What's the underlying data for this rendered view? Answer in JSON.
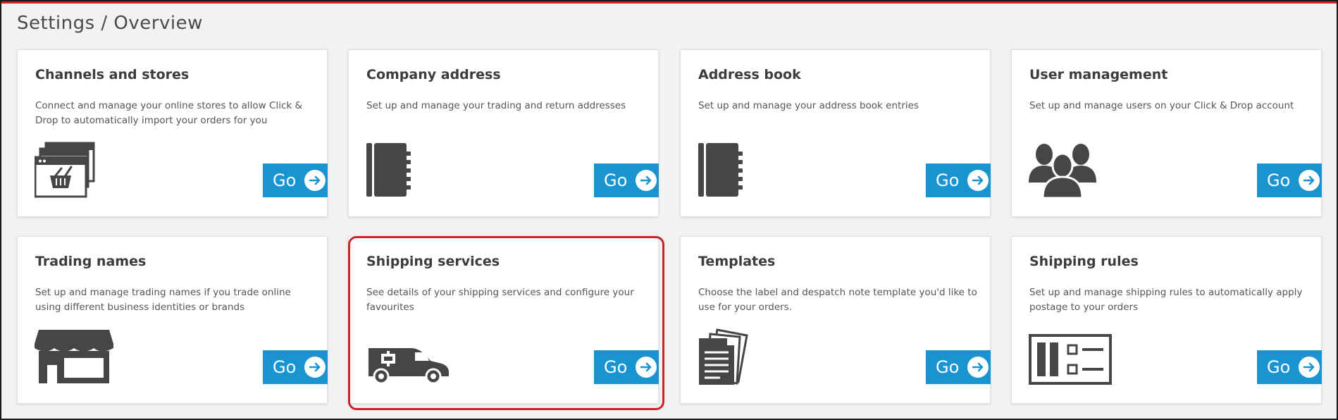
{
  "header": {
    "breadcrumb": "Settings / Overview"
  },
  "colors": {
    "accent_red": "#d3232a",
    "button_blue": "#1a93d1",
    "icon_dark": "#464646"
  },
  "cards": [
    {
      "title": "Channels and stores",
      "description": "Connect and manage your online stores to allow Click & Drop to automatically import your orders for you",
      "button_label": "Go",
      "icon": "store-windows-basket-icon"
    },
    {
      "title": "Company address",
      "description": "Set up and manage your trading and return addresses",
      "button_label": "Go",
      "icon": "address-book-icon"
    },
    {
      "title": "Address book",
      "description": "Set up and manage your address book entries",
      "button_label": "Go",
      "icon": "address-book-icon"
    },
    {
      "title": "User management",
      "description": "Set up and manage users on your Click & Drop account",
      "button_label": "Go",
      "icon": "users-icon"
    },
    {
      "title": "Trading names",
      "description": "Set up and manage trading names if you trade online using different business identities or brands",
      "button_label": "Go",
      "icon": "shopfront-icon"
    },
    {
      "title": "Shipping services",
      "description": "See details of your shipping services and configure your favourites",
      "button_label": "Go",
      "icon": "delivery-van-icon"
    },
    {
      "title": "Templates",
      "description": "Choose the label and despatch note template you'd like to use for your orders.",
      "button_label": "Go",
      "icon": "documents-icon"
    },
    {
      "title": "Shipping rules",
      "description": "Set up and manage shipping rules to automatically apply postage to your orders",
      "button_label": "Go",
      "icon": "rules-panel-icon"
    }
  ]
}
